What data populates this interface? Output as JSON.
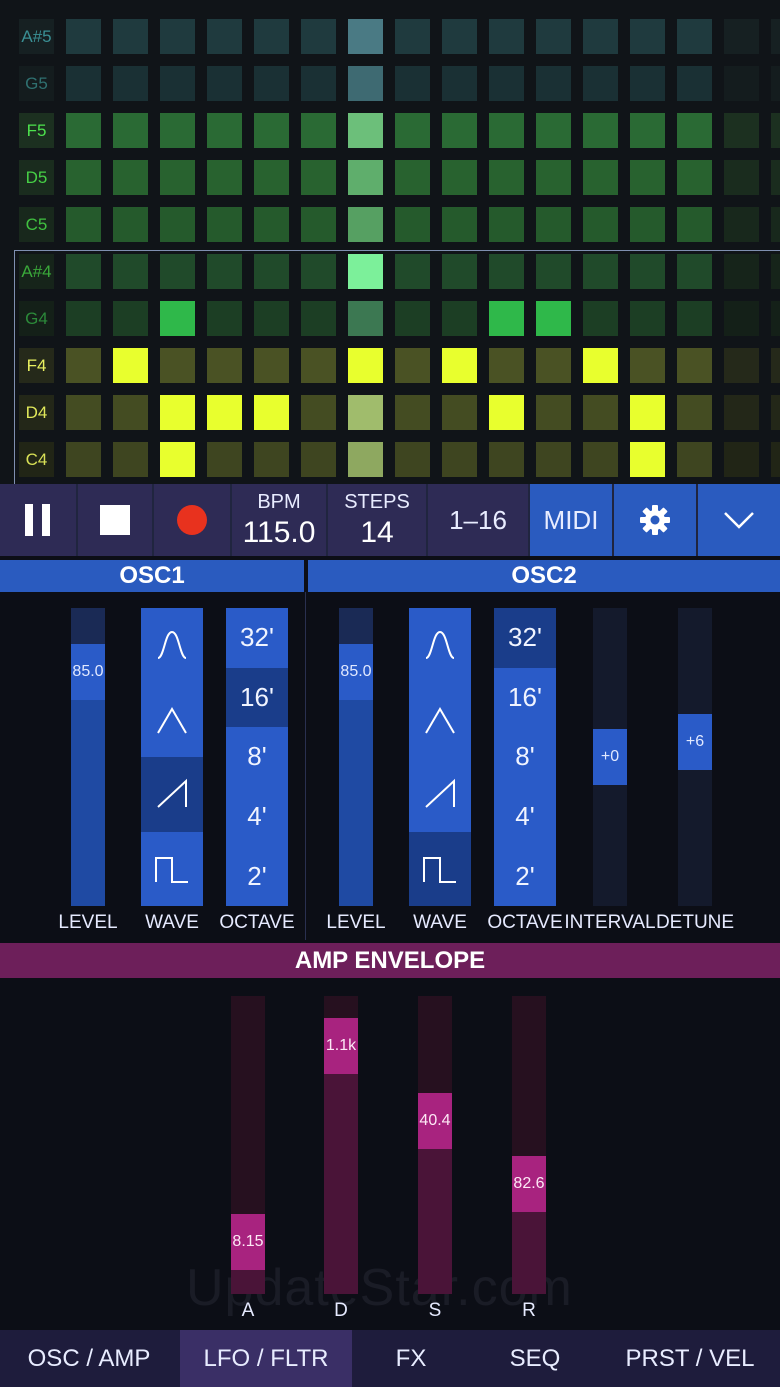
{
  "sequencer": {
    "notes": [
      "A#5",
      "G5",
      "F5",
      "D5",
      "C5",
      "A#4",
      "G4",
      "F4",
      "D4",
      "C4"
    ],
    "note_colors": [
      "#3a8f94",
      "#2f7070",
      "#4de24d",
      "#46d046",
      "#40c040",
      "#3aa83a",
      "#2c8a3a",
      "#e8f060",
      "#e0e85a",
      "#d8e056"
    ],
    "row_base_colors": [
      "#1f3a3e",
      "#1a3034",
      "#2a6a34",
      "#28622f",
      "#255a2c",
      "#204a2a",
      "#1c3e24",
      "#4a5224",
      "#444c22",
      "#3e4520"
    ],
    "row_dim_colors": [
      "#162022",
      "#141c1e",
      "#1c3020",
      "#1a2c1e",
      "#18281c",
      "#16241a",
      "#142018",
      "#25291a",
      "#232718",
      "#212516"
    ],
    "playhead_colors": [
      "#4a7a84",
      "#3e6a72",
      "#6cbf7a",
      "#5fae6c",
      "#56a062",
      "#7cf09a",
      "#3c7852",
      "#e0ff78",
      "#a0bc6c",
      "#8ea860"
    ],
    "active_color_green": "#2fb84a",
    "active_color_yellow": "#e8ff2e",
    "steps_total": 16,
    "steps_active": 14,
    "playhead_step": 7,
    "active_cells": [
      {
        "row": 6,
        "step": 3
      },
      {
        "row": 6,
        "step": 10
      },
      {
        "row": 6,
        "step": 11
      },
      {
        "row": 7,
        "step": 2
      },
      {
        "row": 7,
        "step": 7
      },
      {
        "row": 7,
        "step": 9
      },
      {
        "row": 7,
        "step": 12
      },
      {
        "row": 8,
        "step": 3
      },
      {
        "row": 8,
        "step": 4
      },
      {
        "row": 8,
        "step": 5
      },
      {
        "row": 8,
        "step": 10
      },
      {
        "row": 8,
        "step": 13
      },
      {
        "row": 9,
        "step": 3
      },
      {
        "row": 9,
        "step": 13
      }
    ]
  },
  "transport": {
    "pause_icon": "pause-icon",
    "stop_icon": "stop-icon",
    "record_icon": "record-icon",
    "record_color": "#e8321e",
    "bpm_label": "BPM",
    "bpm_value": "115.0",
    "steps_label": "STEPS",
    "steps_value": "14",
    "range_label": "1–16",
    "midi_label": "MIDI",
    "settings_icon": "gear-icon",
    "collapse_icon": "chevron-down-icon"
  },
  "osc1": {
    "title": "OSC1",
    "level": {
      "label": "LEVEL",
      "value": "85.0",
      "fraction": 0.85
    },
    "wave": {
      "label": "WAVE",
      "options": [
        "sine",
        "triangle",
        "saw",
        "square"
      ],
      "selected": 2
    },
    "octave": {
      "label": "OCTAVE",
      "options": [
        "32'",
        "16'",
        "8'",
        "4'",
        "2'"
      ],
      "selected": 1
    }
  },
  "osc2": {
    "title": "OSC2",
    "level": {
      "label": "LEVEL",
      "value": "85.0",
      "fraction": 0.85
    },
    "wave": {
      "label": "WAVE",
      "options": [
        "sine",
        "triangle",
        "saw",
        "square"
      ],
      "selected": 3
    },
    "octave": {
      "label": "OCTAVE",
      "options": [
        "32'",
        "16'",
        "8'",
        "4'",
        "2'"
      ],
      "selected": 0
    },
    "interval": {
      "label": "INTERVAL",
      "value": "+0",
      "fraction": 0.5
    },
    "detune": {
      "label": "DETUNE",
      "value": "+6",
      "fraction": 0.56
    }
  },
  "amp_envelope": {
    "title": "AMP ENVELOPE",
    "params": [
      {
        "label": "A",
        "value": "8.15",
        "fraction": 0.1
      },
      {
        "label": "D",
        "value": "1.1k",
        "fraction": 0.91
      },
      {
        "label": "S",
        "value": "40.4",
        "fraction": 0.6
      },
      {
        "label": "R",
        "value": "82.6",
        "fraction": 0.34
      }
    ]
  },
  "watermark": "UpdateStar.com",
  "tabs": [
    {
      "label": "OSC / AMP",
      "active": false
    },
    {
      "label": "LFO / FLTR",
      "active": true
    },
    {
      "label": "FX",
      "active": false
    },
    {
      "label": "SEQ",
      "active": false
    },
    {
      "label": "PRST / VEL",
      "active": false
    }
  ]
}
